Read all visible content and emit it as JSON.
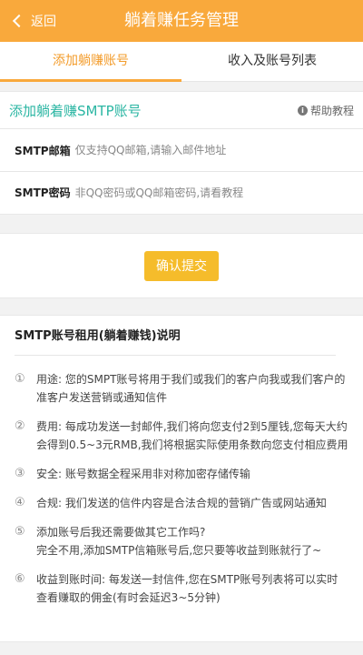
{
  "header": {
    "back_label": "返回",
    "title": "躺着赚任务管理"
  },
  "tabs": [
    {
      "label": "添加躺赚账号",
      "active": true
    },
    {
      "label": "收入及账号列表",
      "active": false
    }
  ],
  "form": {
    "section_title": "添加躺着赚SMTP账号",
    "help_label": "帮助教程",
    "email_label": "SMTP邮箱",
    "email_placeholder": "仅支持QQ邮箱,请输入邮件地址",
    "password_label": "SMTP密码",
    "password_placeholder": "非QQ密码或QQ邮箱密码,请看教程",
    "submit_label": "确认提交"
  },
  "explain": {
    "title": "SMTP账号租用(躺着赚钱)说明",
    "items": [
      {
        "num": "①",
        "lines": [
          "用途: 您的SMPT账号将用于我们或我们的客户向我或我们客户的准客户发送营销或通知信件"
        ]
      },
      {
        "num": "②",
        "lines": [
          "费用: 每成功发送一封邮件,我们将向您支付2到5厘钱,您每天大约会得到0.5~3元RMB,我们将根据实际使用条数向您支付相应费用"
        ]
      },
      {
        "num": "③",
        "lines": [
          "安全: 账号数据全程采用非对称加密存储传输"
        ]
      },
      {
        "num": "④",
        "lines": [
          "合规: 我们发送的信件内容是合法合规的营销广告或网站通知"
        ]
      },
      {
        "num": "⑤",
        "lines": [
          "添加账号后我还需要做其它工作吗?",
          "完全不用,添加SMTP信箱账号后,您只要等收益到账就行了~"
        ]
      },
      {
        "num": "⑥",
        "lines": [
          "收益到账时间: 每发送一封信件,您在SMTP账号列表将可以实时查看赚取的佣金(有时会延迟3~5分钟)"
        ]
      }
    ]
  }
}
